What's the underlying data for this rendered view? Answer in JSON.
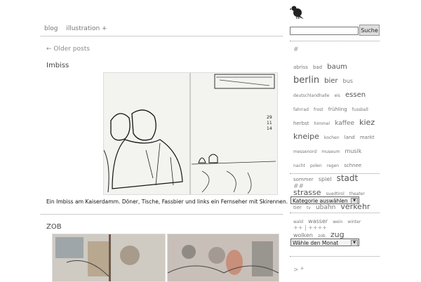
{
  "nav": {
    "items": [
      "blog",
      "illustration +"
    ]
  },
  "older_posts": "← Older posts",
  "posts": [
    {
      "title": "Imbiss",
      "caption": "Ein Imbiss am Kaiserdamm. Döner, Tische, Fassbier und links ein Fernseher mit Skirennen."
    },
    {
      "title": "ZOB"
    }
  ],
  "sketch_date": [
    "29",
    "11",
    "14"
  ],
  "search": {
    "placeholder": "",
    "button": "Suche"
  },
  "sidebar": {
    "tags_heading": "#",
    "tags": [
      {
        "t": "abriss",
        "s": 7
      },
      {
        "t": "bad",
        "s": 7
      },
      {
        "t": "baum",
        "s": 10
      },
      {
        "t": "berlin",
        "s": 13
      },
      {
        "t": "bier",
        "s": 10
      },
      {
        "t": "bus",
        "s": 8
      },
      {
        "t": "deutschlandhalle",
        "s": 6
      },
      {
        "t": "eis",
        "s": 6
      },
      {
        "t": "essen",
        "s": 10
      },
      {
        "t": "fahrrad",
        "s": 6
      },
      {
        "t": "frost",
        "s": 6
      },
      {
        "t": "frühling",
        "s": 7
      },
      {
        "t": "fussball",
        "s": 6
      },
      {
        "t": "herbst",
        "s": 7
      },
      {
        "t": "himmel",
        "s": 6
      },
      {
        "t": "kaffee",
        "s": 9
      },
      {
        "t": "kiez",
        "s": 11
      },
      {
        "t": "kneipe",
        "s": 11
      },
      {
        "t": "kochen",
        "s": 6
      },
      {
        "t": "land",
        "s": 7
      },
      {
        "t": "markt",
        "s": 7
      },
      {
        "t": "messenord",
        "s": 6
      },
      {
        "t": "museum",
        "s": 6
      },
      {
        "t": "musik",
        "s": 8
      },
      {
        "t": "nacht",
        "s": 6
      },
      {
        "t": "polen",
        "s": 6
      },
      {
        "t": "regen",
        "s": 6
      },
      {
        "t": "schnee",
        "s": 7
      },
      {
        "t": "sommer",
        "s": 7
      },
      {
        "t": "spiel",
        "s": 8
      },
      {
        "t": "stadt",
        "s": 12
      },
      {
        "t": "strasse",
        "s": 11
      },
      {
        "t": "suedtirol",
        "s": 6
      },
      {
        "t": "theater",
        "s": 6
      },
      {
        "t": "tier",
        "s": 7
      },
      {
        "t": "tv",
        "s": 6
      },
      {
        "t": "ubahn",
        "s": 9
      },
      {
        "t": "verkehr",
        "s": 11
      },
      {
        "t": "wald",
        "s": 6
      },
      {
        "t": "wasser",
        "s": 8
      },
      {
        "t": "wein",
        "s": 6
      },
      {
        "t": "winter",
        "s": 6
      },
      {
        "t": "wolken",
        "s": 8
      },
      {
        "t": "zob",
        "s": 6
      },
      {
        "t": "zug",
        "s": 11
      }
    ],
    "categories_heading": "##",
    "categories_select": "Kategorie auswählen",
    "archive_heading": "++ | ++++",
    "archive_select": "Wähle den Monat",
    "bottom_heading": "> *"
  }
}
